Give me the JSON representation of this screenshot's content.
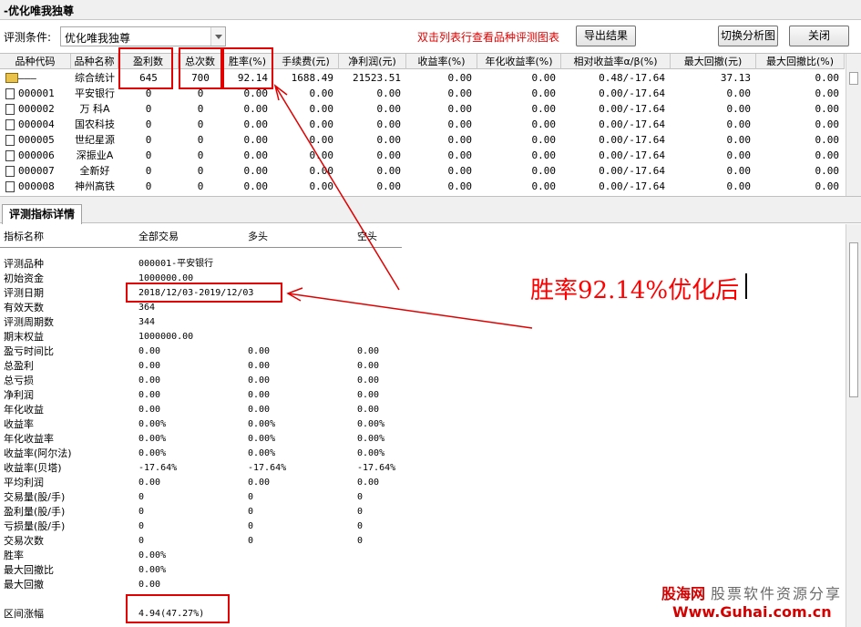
{
  "window": {
    "title": "-优化唯我独尊"
  },
  "toolbar": {
    "condition_label": "评测条件:",
    "condition_value": "优化唯我独尊",
    "hint": "双击列表行查看品种评测图表",
    "export_label": "导出结果",
    "switch_label": "切换分析图",
    "close_label": "关闭"
  },
  "grid": {
    "headers": [
      "品种代码",
      "品种名称",
      "盈利数",
      "总次数",
      "胜率(%)",
      "手续费(元)",
      "净利润(元)",
      "收益率(%)",
      "年化收益率(%)",
      "相对收益率α/β(%)",
      "最大回撤(元)",
      "最大回撤比(%)"
    ],
    "rows": [
      [
        "———",
        "综合统计",
        "645",
        "700",
        "92.14",
        "1688.49",
        "21523.51",
        "0.00",
        "0.00",
        "0.48/-17.64",
        "37.13",
        "0.00"
      ],
      [
        "000001",
        "平安银行",
        "0",
        "0",
        "0.00",
        "0.00",
        "0.00",
        "0.00",
        "0.00",
        "0.00/-17.64",
        "0.00",
        "0.00"
      ],
      [
        "000002",
        "万 科A",
        "0",
        "0",
        "0.00",
        "0.00",
        "0.00",
        "0.00",
        "0.00",
        "0.00/-17.64",
        "0.00",
        "0.00"
      ],
      [
        "000004",
        "国农科技",
        "0",
        "0",
        "0.00",
        "0.00",
        "0.00",
        "0.00",
        "0.00",
        "0.00/-17.64",
        "0.00",
        "0.00"
      ],
      [
        "000005",
        "世纪星源",
        "0",
        "0",
        "0.00",
        "0.00",
        "0.00",
        "0.00",
        "0.00",
        "0.00/-17.64",
        "0.00",
        "0.00"
      ],
      [
        "000006",
        "深振业A",
        "0",
        "0",
        "0.00",
        "0.00",
        "0.00",
        "0.00",
        "0.00",
        "0.00/-17.64",
        "0.00",
        "0.00"
      ],
      [
        "000007",
        "全新好",
        "0",
        "0",
        "0.00",
        "0.00",
        "0.00",
        "0.00",
        "0.00",
        "0.00/-17.64",
        "0.00",
        "0.00"
      ],
      [
        "000008",
        "神州高铁",
        "0",
        "0",
        "0.00",
        "0.00",
        "0.00",
        "0.00",
        "0.00",
        "0.00/-17.64",
        "0.00",
        "0.00"
      ]
    ]
  },
  "detail": {
    "tab_label": "评测指标详情",
    "headers": [
      "指标名称",
      "全部交易",
      "多头",
      "空头"
    ],
    "rows": [
      [
        "评测品种",
        "000001-平安银行",
        "",
        ""
      ],
      [
        "初始资金",
        "1000000.00",
        "",
        ""
      ],
      [
        "评测日期",
        "2018/12/03-2019/12/03",
        "",
        ""
      ],
      [
        "有效天数",
        "364",
        "",
        ""
      ],
      [
        "评测周期数",
        "344",
        "",
        ""
      ],
      [
        "期末权益",
        "1000000.00",
        "",
        ""
      ],
      [
        "盈亏时间比",
        "0.00",
        "0.00",
        "0.00"
      ],
      [
        "总盈利",
        "0.00",
        "0.00",
        "0.00"
      ],
      [
        "总亏损",
        "0.00",
        "0.00",
        "0.00"
      ],
      [
        "净利润",
        "0.00",
        "0.00",
        "0.00"
      ],
      [
        "年化收益",
        "0.00",
        "0.00",
        "0.00"
      ],
      [
        "收益率",
        "0.00%",
        "0.00%",
        "0.00%"
      ],
      [
        "年化收益率",
        "0.00%",
        "0.00%",
        "0.00%"
      ],
      [
        "收益率(阿尔法)",
        "0.00%",
        "0.00%",
        "0.00%"
      ],
      [
        "收益率(贝塔)",
        "-17.64%",
        "-17.64%",
        "-17.64%"
      ],
      [
        "平均利润",
        "0.00",
        "0.00",
        "0.00"
      ],
      [
        "交易量(股/手)",
        "0",
        "0",
        "0"
      ],
      [
        "盈利量(股/手)",
        "0",
        "0",
        "0"
      ],
      [
        "亏损量(股/手)",
        "0",
        "0",
        "0"
      ],
      [
        "交易次数",
        "0",
        "0",
        "0"
      ],
      [
        "胜率",
        "0.00%",
        "",
        ""
      ],
      [
        "最大回撤比",
        "0.00%",
        "",
        ""
      ],
      [
        "最大回撤",
        "0.00",
        "",
        ""
      ]
    ],
    "range_label": "区间涨幅",
    "range_value": "4.94(47.27%)"
  },
  "annotation": {
    "text": "胜率92.14%优化后",
    "color": "#ff0000"
  },
  "watermark": {
    "brand": "股海网",
    "slogan": "股票软件资源分享",
    "url": "Www.Guhai.com.cn"
  },
  "icons": {
    "summary_row": "folder-icon",
    "stock_row": "document-icon",
    "combo": "chevron-down-icon"
  }
}
